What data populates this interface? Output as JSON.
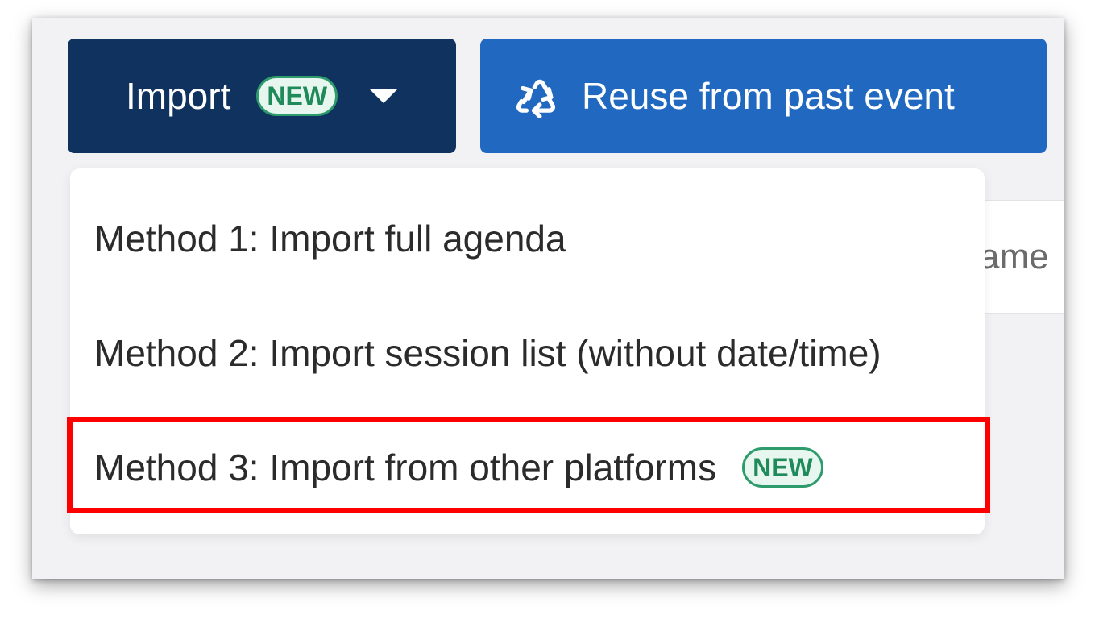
{
  "toolbar": {
    "import_label": "Import",
    "import_badge": "NEW",
    "reuse_label": "Reuse from past event"
  },
  "background": {
    "partial_text": "ame"
  },
  "dropdown": {
    "items": [
      {
        "label": "Method 1: Import full agenda",
        "badge": ""
      },
      {
        "label": "Method 2: Import session list (without date/time)",
        "badge": ""
      },
      {
        "label": "Method 3: Import from other platforms",
        "badge": "NEW",
        "highlighted": true
      }
    ]
  },
  "colors": {
    "import_button": "#10325e",
    "reuse_button": "#2169c0",
    "badge_green": "#2e9b6c",
    "highlight": "#ff0000"
  },
  "icons": {
    "reuse": "recycle-icon",
    "dropdown": "caret-down-icon"
  }
}
